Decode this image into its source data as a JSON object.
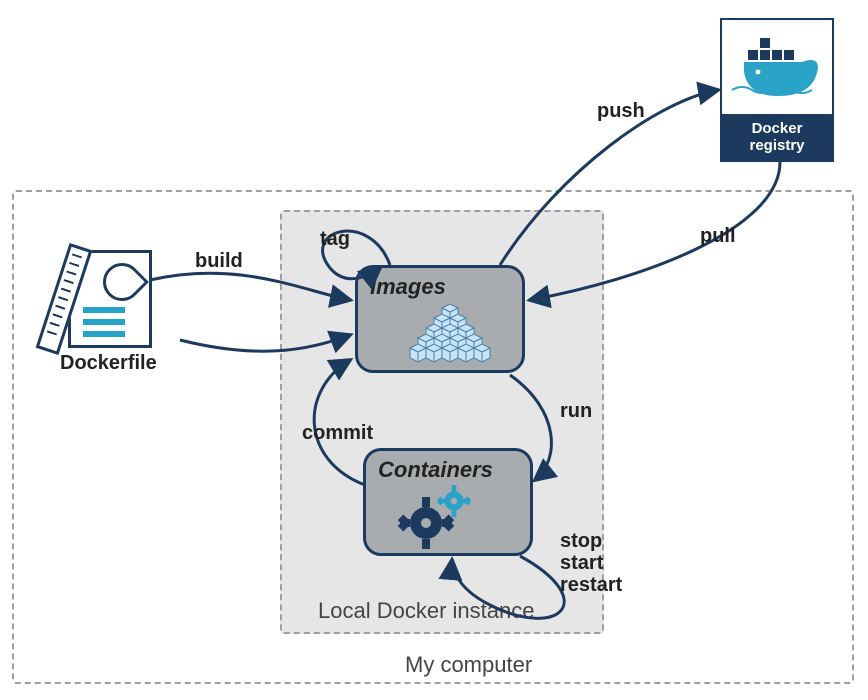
{
  "colors": {
    "stroke": "#1c3a5e",
    "node_fill": "#a9acae",
    "panel_fill": "#e6e6e7",
    "dash": "#9aa0a6",
    "water": "#2aa3c9",
    "cube": "#6fb7e8"
  },
  "nodes": {
    "dockerfile": {
      "label": "Dockerfile"
    },
    "images": {
      "title": "Images"
    },
    "containers": {
      "title": "Containers"
    },
    "registry": {
      "label": "Docker registry"
    }
  },
  "panels": {
    "my_computer": "My computer",
    "local_docker": "Local Docker instance"
  },
  "edges": {
    "build": "build",
    "tag": "tag",
    "push": "push",
    "pull": "pull",
    "run": "run",
    "commit": "commit",
    "stop": "stop",
    "start": "start",
    "restart": "restart"
  }
}
